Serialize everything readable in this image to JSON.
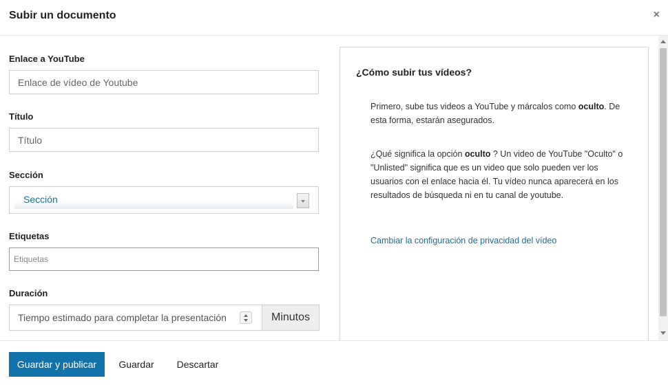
{
  "dialog": {
    "title": "Subir un documento",
    "close_glyph": "×",
    "close_icon": "close-icon"
  },
  "form": {
    "youtube_link": {
      "label": "Enlace a YouTube",
      "value": "",
      "placeholder": "Enlace de vídeo de Youtube"
    },
    "title_field": {
      "label": "Título",
      "value": "",
      "placeholder": "Título"
    },
    "section": {
      "label": "Sección",
      "selected": "Sección",
      "arrow_icon": "chevron-down-icon"
    },
    "tags": {
      "label": "Etiquetas",
      "value": "",
      "placeholder": "Etiquetas"
    },
    "duration": {
      "label": "Duración",
      "value": "",
      "placeholder": "Tiempo estimado para completar la presentación",
      "unit": "Minutos",
      "spinner_icon": "spinner-arrows-icon"
    }
  },
  "help": {
    "title": "¿Cómo subir tus vídeos?",
    "p1_a": "Primero, sube tus videos a YouTube y márcalos como ",
    "p1_b": "oculto",
    "p1_c": ". De esta forma, estarán asegurados.",
    "p2_a": "¿Qué significa la opción ",
    "p2_b": "oculto",
    "p2_c": " ? Un video de YouTube \"Oculto\" o \"Unlisted\" significa que es un video que solo pueden ver los usuarios con el enlace hacia él. Tu vídeo nunca aparecerá en los resultados de búsqueda ni en tu canal de youtube.",
    "link": "Cambiar la configuración de privacidad del vídeo"
  },
  "footer": {
    "primary": "Guardar y publicar",
    "save": "Guardar",
    "discard": "Descartar"
  },
  "colors": {
    "accent": "#1272aa",
    "link": "#1a6e9c",
    "addon_bg": "#eceef0"
  }
}
